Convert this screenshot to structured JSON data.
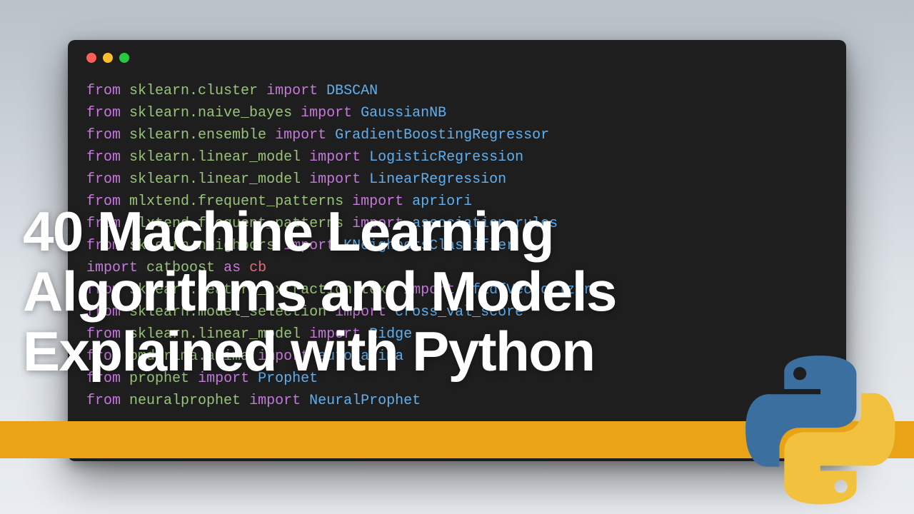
{
  "headline": "40 Machine Learning\nAlgorithms and Models\nExplained with Python",
  "code_lines": [
    {
      "from": "sklearn.cluster",
      "import": "DBSCAN"
    },
    {
      "from": "sklearn.naive_bayes",
      "import": "GaussianNB"
    },
    {
      "from": "sklearn.ensemble",
      "import": "GradientBoostingRegressor"
    },
    {
      "from": "sklearn.linear_model",
      "import": "LogisticRegression"
    },
    {
      "from": "sklearn.linear_model",
      "import": "LinearRegression"
    },
    {
      "from": "mlxtend.frequent_patterns",
      "import": "apriori"
    },
    {
      "from": "mlxtend.frequent_patterns",
      "import": "association_rules"
    },
    {
      "from": "sklearn.neighbors",
      "import": "KNeighborsClassifier"
    },
    {
      "import_only": "catboost",
      "as": "cb"
    },
    {
      "from": "sklearn.feature_extraction.text",
      "import": "TfidfVectorizer"
    },
    {
      "from": "sklearn.model_selection",
      "import": "cross_val_score"
    },
    {
      "from": "sklearn.linear_model",
      "import": "Ridge"
    },
    {
      "from": "pmdarima.arima",
      "import": "auto_arima"
    },
    {
      "from": "prophet",
      "import": "Prophet"
    },
    {
      "from": "neuralprophet",
      "import": "NeuralProphet"
    }
  ],
  "window_controls": [
    "close",
    "minimize",
    "maximize"
  ]
}
